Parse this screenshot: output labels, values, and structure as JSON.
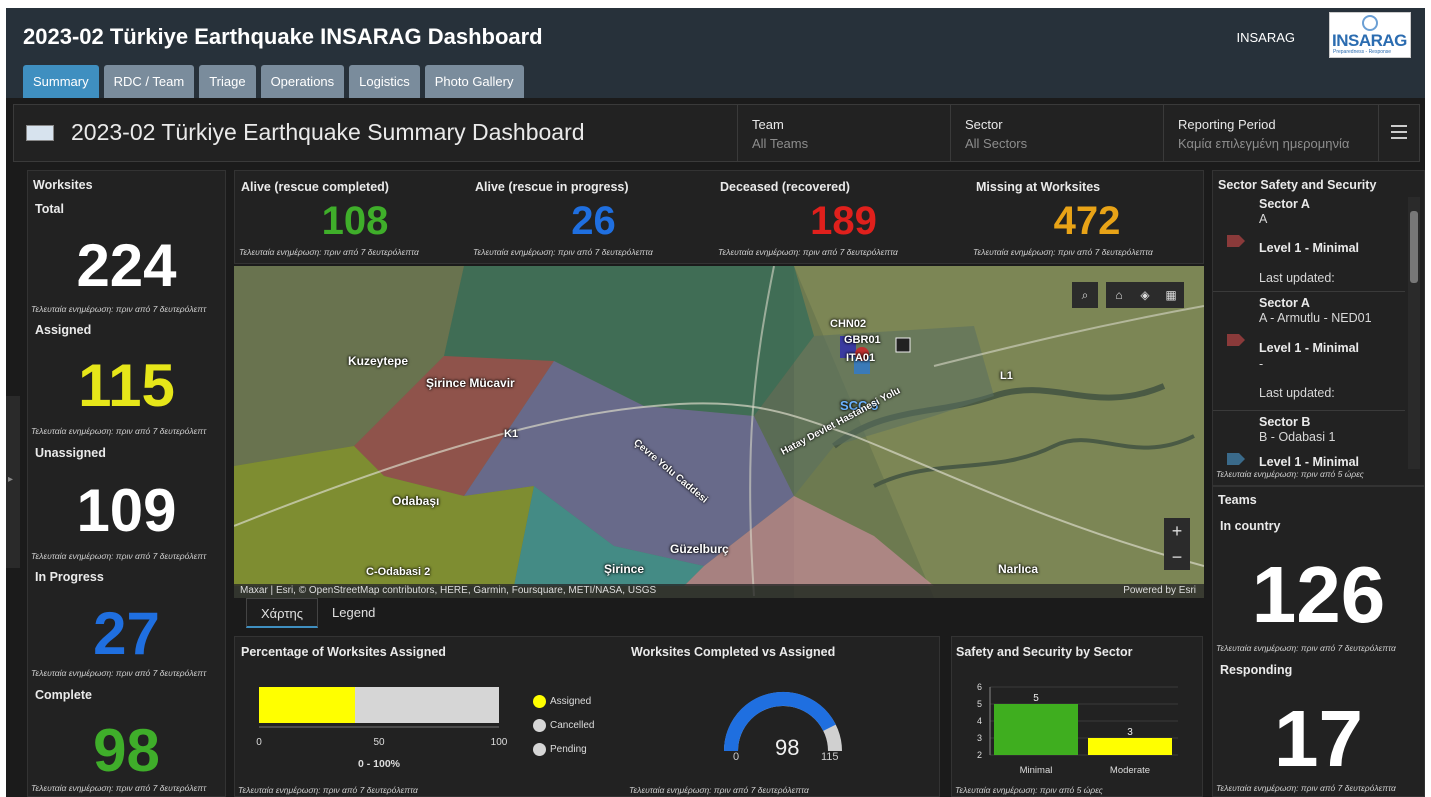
{
  "app": {
    "title": "2023-02 Türkiye Earthquake INSARAG Dashboard",
    "org": "INSARAG",
    "logo_text": "INSARAG",
    "logo_sub": "Preparedness - Response"
  },
  "tabs": [
    "Summary",
    "RDC / Team",
    "Triage",
    "Operations",
    "Logistics",
    "Photo Gallery"
  ],
  "header": {
    "title": "2023-02 Türkiye Earthquake Summary Dashboard",
    "filters": [
      {
        "label": "Team",
        "value": "All Teams"
      },
      {
        "label": "Sector",
        "value": "All Sectors"
      },
      {
        "label": "Reporting Period",
        "value": "Καμία επιλεγμένη ημερομηνία"
      }
    ]
  },
  "worksites": {
    "title": "Worksites",
    "updated": "Τελευταία ενημέρωση: πριν από 7 δευτερόλεπτ",
    "items": [
      {
        "label": "Total",
        "value": "224",
        "color": "#ffffff"
      },
      {
        "label": "Assigned",
        "value": "115",
        "color": "#e6e619"
      },
      {
        "label": "Unassigned",
        "value": "109",
        "color": "#ffffff"
      },
      {
        "label": "In Progress",
        "value": "27",
        "color": "#1f6fe0"
      },
      {
        "label": "Complete",
        "value": "98",
        "color": "#3fae2a"
      }
    ]
  },
  "kpis": {
    "updated": "Τελευταία ενημέρωση: πριν από 7 δευτερόλεπτα",
    "items": [
      {
        "label": "Alive (rescue completed)",
        "value": "108",
        "color": "#3fae2a"
      },
      {
        "label": "Alive (rescue in progress)",
        "value": "26",
        "color": "#1f6fe0"
      },
      {
        "label": "Deceased (recovered)",
        "value": "189",
        "color": "#e0201c"
      },
      {
        "label": "Missing at Worksites",
        "value": "472",
        "color": "#e8a317"
      }
    ]
  },
  "map": {
    "labels": {
      "kuzeytepe": "Kuzeytepe",
      "sirince_mucavir": "Şirince Mücavir",
      "odabasi": "Odabaşı",
      "guzelburc": "Güzelburç",
      "sirince": "Şirince",
      "narlica": "Narlıca",
      "chn02": "CHN02",
      "gbr01": "GBR01",
      "ita01": "ITA01",
      "scc5": "SCC 5",
      "l1": "L1",
      "k1": "K1",
      "odabasi2": "C-Odabasi 2",
      "road_cevre": "Çevre Yolu Caddesi",
      "road_hatay": "Hatay Devlet Hastanesi Yolu"
    },
    "attribution": "Maxar | Esri, © OpenStreetMap contributors, HERE, Garmin, Foursquare, METI/NASA, USGS",
    "powered": "Powered by Esri",
    "zoom_in": "+",
    "zoom_out": "−"
  },
  "map_tabs": [
    "Χάρτης",
    "Legend"
  ],
  "pct_assigned": {
    "title": "Percentage of Worksites Assigned",
    "range_label": "0 - 100%",
    "ticks": [
      "0",
      "50",
      "100"
    ],
    "legend": [
      {
        "label": "Assigned",
        "color": "#ffff00"
      },
      {
        "label": "Cancelled",
        "color": "#d6d6d6"
      },
      {
        "label": "Pending",
        "color": "#d6d6d6"
      }
    ],
    "updated": "Τελευταία ενημέρωση: πριν από 7 δευτερόλεπτα"
  },
  "gauge": {
    "title": "Worksites Completed vs Assigned",
    "value": "98",
    "min": "0",
    "max": "115",
    "updated": "Τελευταία ενημέρωση: πριν από 7 δευτερόλεπτα"
  },
  "safety_chart": {
    "title": "Safety and Security by Sector",
    "updated": "Τελευταία ενημέρωση: πριν από 5 ώρες"
  },
  "sector_safety": {
    "title": "Sector Safety and Security",
    "updated": "Τελευταία ενημέρωση: πριν από 5 ώρες",
    "items": [
      {
        "name": "Sector A",
        "desc": "A",
        "level": "Level 1 - Minimal",
        "updated": "Last updated:",
        "icon_color": "#8a3a3a"
      },
      {
        "name": "Sector A",
        "desc": "A - Armutlu - NED01",
        "desc2": "-",
        "level": "Level 1 - Minimal",
        "updated": "Last updated:",
        "icon_color": "#8a3a3a"
      },
      {
        "name": "Sector B",
        "desc": "B - Odabasi 1",
        "level": "Level 1 - Minimal",
        "icon_color": "#3a6a8a"
      }
    ]
  },
  "teams": {
    "title": "Teams",
    "in_country_label": "In country",
    "in_country": "126",
    "responding_label": "Responding",
    "responding": "17",
    "updated": "Τελευταία ενημέρωση: πριν από 7 δευτερόλεπτα"
  },
  "chart_data": [
    {
      "type": "bar",
      "orientation": "horizontal-stacked",
      "title": "Percentage of Worksites Assigned",
      "xlabel": "0 - 100%",
      "xlim": [
        0,
        100
      ],
      "xticks": [
        0,
        50,
        100
      ],
      "series": [
        {
          "name": "Assigned",
          "values": [
            40
          ],
          "color": "#ffff00"
        },
        {
          "name": "Pending",
          "values": [
            60
          ],
          "color": "#d6d6d6"
        }
      ]
    },
    {
      "type": "bar",
      "title": "Safety and Security by Sector",
      "categories": [
        "Minimal",
        "Moderate"
      ],
      "values": [
        5,
        3
      ],
      "colors": [
        "#3fae1f",
        "#ffff00"
      ],
      "ylim": [
        2,
        6
      ],
      "yticks": [
        2,
        3,
        4,
        5,
        6
      ]
    }
  ]
}
